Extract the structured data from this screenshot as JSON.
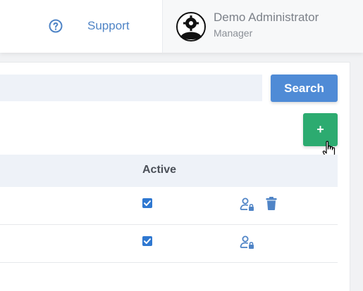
{
  "header": {
    "support_label": "Support",
    "user": {
      "name": "Demo Administrator",
      "role": "Manager"
    }
  },
  "toolbar": {
    "search_label": "Search",
    "add_label": "+"
  },
  "table": {
    "columns": [
      "Active"
    ],
    "rows": [
      {
        "active": true,
        "actions": [
          "user-lock-icon",
          "trash-icon"
        ]
      },
      {
        "active": true,
        "actions": [
          "user-lock-icon"
        ]
      }
    ]
  },
  "colors": {
    "primary": "#4f8bd6",
    "success": "#2cab70",
    "link": "#4f84c6"
  }
}
